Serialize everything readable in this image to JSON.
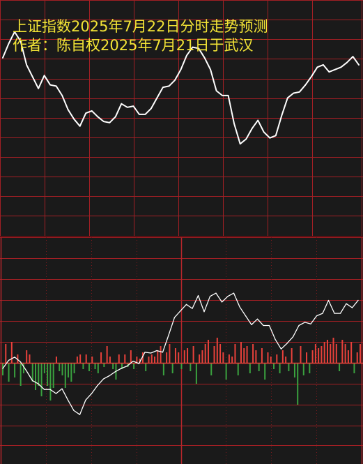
{
  "title_line1": "上证指数2025年7月22日分时走势预测",
  "title_line2": "作者：陈自权2025年7月21日于武汉",
  "colors": {
    "background": "#000000",
    "panel_background": "#1a1a1a",
    "grid": "#a21f24",
    "border": "#b3262b",
    "title": "#f3e436",
    "line": "#ffffff",
    "volume_up": "#e8413b",
    "volume_down": "#3aa23f",
    "dotted_grid": "#7a1a1e"
  },
  "chart_data": [
    {
      "type": "line",
      "title": "上证指数2025年7月22日分时走势预测",
      "xlabel": "",
      "ylabel": "",
      "grid": true,
      "x": [
        0,
        1,
        2,
        3,
        4,
        5,
        6,
        7,
        8,
        9,
        10,
        11,
        12,
        13,
        14,
        15,
        16,
        17,
        18,
        19,
        20,
        21,
        22,
        23,
        24,
        25,
        26,
        27,
        28,
        29,
        30,
        31,
        32,
        33,
        34,
        35,
        36,
        37,
        38,
        39,
        40,
        41,
        42,
        43,
        44,
        45,
        46,
        47,
        48,
        49,
        50,
        51,
        52,
        53,
        54,
        55,
        56,
        57,
        58,
        59,
        60
      ],
      "series": [
        {
          "values": [
            7.55,
            8.15,
            8.65,
            8.25,
            7.25,
            6.75,
            6.25,
            6.8,
            6.4,
            6.35,
            5.95,
            5.35,
            4.95,
            4.65,
            5.2,
            5.3,
            5.05,
            4.85,
            4.8,
            5.05,
            5.6,
            5.45,
            5.5,
            5.15,
            5.15,
            5.4,
            5.85,
            6.3,
            6.35,
            6.6,
            7.05,
            7.65,
            8.0,
            7.95,
            7.55,
            7.05,
            6.15,
            5.95,
            5.95,
            4.75,
            3.9,
            4.1,
            4.55,
            4.9,
            4.4,
            4.15,
            4.25,
            5.1,
            5.85,
            6.05,
            6.1,
            6.4,
            6.75,
            7.15,
            7.25,
            6.95,
            7.05,
            7.15,
            7.35,
            7.6,
            7.25
          ]
        }
      ],
      "ylim": [
        0,
        10
      ]
    },
    {
      "type": "line",
      "title": "",
      "xlabel": "",
      "ylabel": "",
      "grid": true,
      "x": [
        0,
        1,
        2,
        3,
        4,
        5,
        6,
        7,
        8,
        9,
        10,
        11,
        12,
        13,
        14,
        15,
        16,
        17,
        18,
        19,
        20,
        21,
        22,
        23,
        24,
        25,
        26,
        27,
        28,
        29,
        30,
        31,
        32,
        33,
        34,
        35,
        36,
        37,
        38,
        39,
        40,
        41,
        42,
        43,
        44,
        45,
        46,
        47,
        48,
        49,
        50,
        51,
        52,
        53,
        54,
        55,
        56,
        57,
        58,
        59,
        60
      ],
      "series": [
        {
          "values": [
            5.9,
            6.4,
            6.6,
            6.3,
            5.75,
            5.15,
            4.95,
            4.6,
            4.6,
            4.35,
            4.65,
            3.95,
            3.3,
            3.05,
            3.95,
            4.35,
            4.85,
            5.25,
            5.45,
            5.7,
            5.9,
            6.05,
            6.35,
            6.2,
            6.9,
            6.85,
            7.0,
            6.9,
            7.95,
            9.05,
            9.45,
            9.85,
            9.6,
            10.4,
            9.4,
            10.35,
            10.55,
            10.0,
            10.35,
            10.55,
            9.7,
            9.15,
            8.6,
            8.95,
            8.55,
            8.55,
            7.7,
            7.1,
            7.45,
            7.85,
            8.55,
            8.75,
            8.65,
            9.15,
            9.3,
            10.1,
            9.3,
            9.3,
            9.9,
            9.65,
            10.1
          ]
        }
      ],
      "ylim": [
        0,
        14
      ]
    },
    {
      "type": "bar",
      "title": "",
      "xlabel": "",
      "ylabel": "",
      "grid": false,
      "x": [
        0,
        1,
        2,
        3,
        4,
        5,
        6,
        7,
        8,
        9,
        10,
        11,
        12,
        13,
        14,
        15,
        16,
        17,
        18,
        19,
        20,
        21,
        22,
        23,
        24,
        25,
        26,
        27,
        28,
        29,
        30,
        31,
        32,
        33,
        34,
        35,
        36,
        37,
        38,
        39,
        40,
        41,
        42,
        43,
        44,
        45,
        46,
        47,
        48,
        49,
        50,
        51,
        52,
        53,
        54,
        55,
        56,
        57,
        58,
        59,
        60,
        61,
        62,
        63,
        64,
        65,
        66,
        67,
        68,
        69,
        70,
        71,
        72,
        73,
        74,
        75,
        76,
        77,
        78,
        79,
        80,
        81,
        82,
        83,
        84,
        85,
        86,
        87,
        88,
        89,
        90,
        91,
        92,
        93,
        94,
        95,
        96,
        97,
        98,
        99,
        100,
        101,
        102,
        103,
        104,
        105,
        106,
        107,
        108,
        109,
        110,
        111,
        112,
        113,
        114,
        115,
        116,
        117,
        118,
        119,
        120
      ],
      "series": [
        {
          "values": [
            -0.6,
            0.9,
            -0.9,
            1.0,
            -0.7,
            0.4,
            -1.1,
            -0.5,
            0.6,
            0.4,
            -0.9,
            -1.3,
            -1.1,
            -1.6,
            -0.5,
            -1.1,
            -1.8,
            -1.2,
            0.3,
            -0.4,
            -0.6,
            -1.2,
            -0.7,
            -0.9,
            -0.5,
            0.3,
            0.4,
            -0.3,
            0.4,
            -0.4,
            0.3,
            -0.3,
            -0.5,
            0.5,
            -0.2,
            0.8,
            0.3,
            -0.3,
            -0.8,
            0.4,
            -0.3,
            0.4,
            -0.2,
            0.6,
            -0.3,
            0.3,
            0.2,
            0.5,
            -0.4,
            0.3,
            0.4,
            0.3,
            0.6,
            0.8,
            -0.6,
            0.5,
            0.9,
            -0.5,
            0.7,
            0.5,
            -0.3,
            0.6,
            0.7,
            -0.4,
            0.8,
            -1.0,
            0.4,
            0.6,
            0.9,
            1.1,
            -0.6,
            0.8,
            1.2,
            0.9,
            0.5,
            -0.8,
            0.4,
            0.3,
            0.9,
            -0.6,
            1.0,
            0.7,
            0.8,
            -0.5,
            0.9,
            0.6,
            -0.4,
            0.7,
            -0.8,
            0.5,
            0.3,
            -0.3,
            0.4,
            -0.5,
            0.6,
            0.3,
            -0.4,
            0.7,
            -0.7,
            -2.0,
            0.8,
            -0.6,
            0.5,
            -0.5,
            0.6,
            0.9,
            0.7,
            0.8,
            1.0,
            1.1,
            0.9,
            1.2,
            0.9,
            -0.4,
            1.1,
            0.9,
            0.6,
            1.0,
            -0.5,
            0.5,
            0.9
          ]
        }
      ],
      "ylim": [
        -2.2,
        2.2
      ]
    }
  ]
}
